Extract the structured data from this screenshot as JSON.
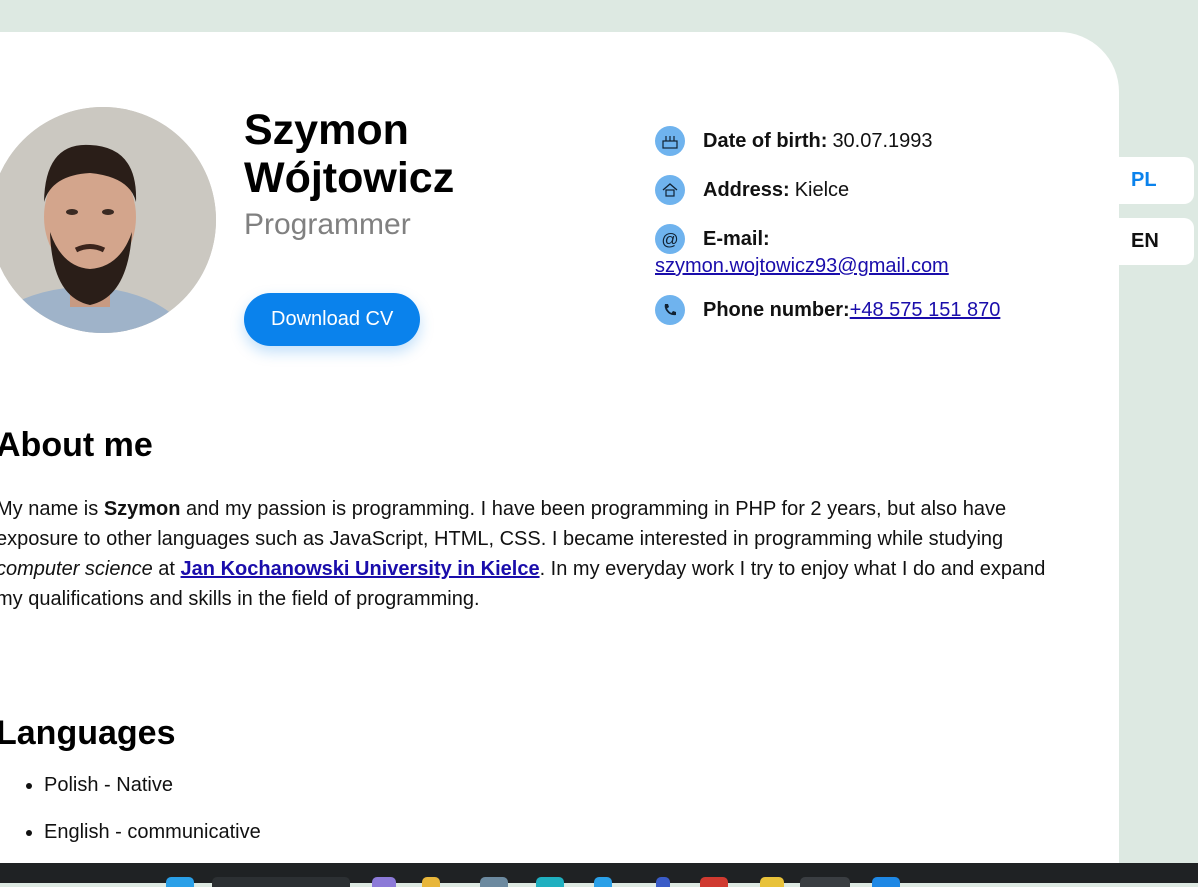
{
  "profile": {
    "name_line1": "Szymon",
    "name_line2": "Wójtowicz",
    "role": "Programmer",
    "download_label": "Download CV"
  },
  "info": {
    "birth_label": "Date of birth:",
    "birth_value": "30.07.1993",
    "address_label": "Address:",
    "address_value": "Kielce",
    "email_label": "E-mail:",
    "email_value": "szymon.wojtowicz93@gmail.com",
    "phone_label": "Phone number:",
    "phone_value": "+48 575 151 870"
  },
  "about": {
    "heading": "About me",
    "t1": "My name is ",
    "t2": "Szymon",
    "t3": " and my passion is programming. I have been programming in PHP for 2 years, but also have exposure to other languages such as JavaScript, HTML, CSS. I became interested in programming while studying ",
    "t4": "computer science",
    "t5": " at ",
    "link": "Jan Kochanowski University in Kielce",
    "t6": ". In my everyday work I try to enjoy what I do and expand my qualifications and skills in the field of programming."
  },
  "languages": {
    "heading": "Languages",
    "items": [
      "Polish - Native",
      "English - communicative"
    ]
  },
  "lang_switch": {
    "pl": "PL",
    "en": "EN"
  },
  "colors": {
    "accent": "#0a82ec",
    "icon_bg": "#6fb3ee",
    "page_bg": "#dde9e2"
  }
}
